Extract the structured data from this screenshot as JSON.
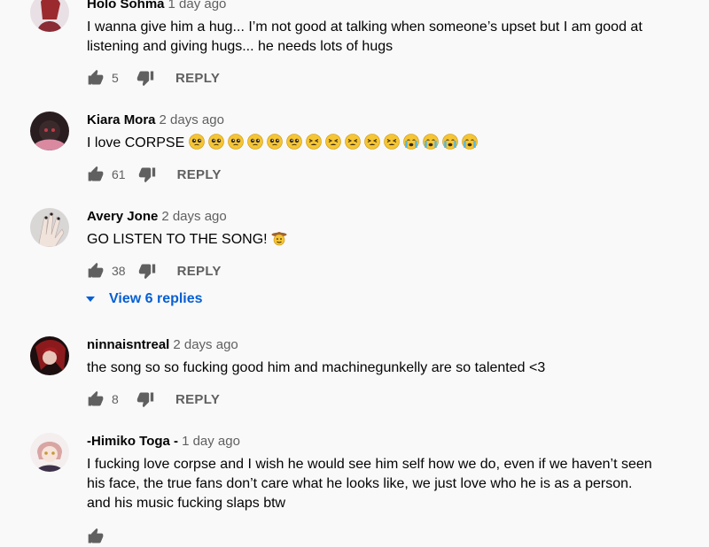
{
  "reply_label": "REPLY",
  "comments": [
    {
      "author": "Holo Sohma",
      "time": "1 day ago",
      "text": "I wanna give him a hug... I’m not good at talking when someone’s upset but I am good at listening and giving hugs... he needs lots of hugs",
      "likes": "5"
    },
    {
      "author": "Kiara Mora",
      "time": "2 days ago",
      "text": "I love CORPSE",
      "emojis": [
        "pleading-face-icon",
        "pleading-face-icon",
        "pleading-face-icon",
        "pleading-face-icon",
        "pleading-face-icon",
        "pleading-face-icon",
        "tired-face-icon",
        "tired-face-icon",
        "tired-face-icon",
        "tired-face-icon",
        "tired-face-icon",
        "crying-face-icon",
        "crying-face-icon",
        "crying-face-icon",
        "crying-face-icon"
      ],
      "likes": "61"
    },
    {
      "author": "Avery Jone",
      "time": "2 days ago",
      "text": "GO LISTEN TO THE SONG!",
      "emojis": [
        "cowboy-face-icon"
      ],
      "likes": "38",
      "view_replies": "View 6 replies"
    },
    {
      "author": "ninnaisntreal",
      "time": "2 days ago",
      "text": "the song so so fucking good him and machinegunkelly are so talented <3",
      "likes": "8"
    },
    {
      "author": "-Himiko Toga -",
      "time": "1 day ago",
      "text": "I fucking love corpse and I wish he would see him self how we do, even if we haven’t seen his face, the true fans don’t care what he looks like, we just love who he is as a person. and his music fucking slaps btw"
    }
  ],
  "colors": {
    "link": "#065fd4",
    "secondary_text": "#606060",
    "background": "#f9f9f9"
  }
}
